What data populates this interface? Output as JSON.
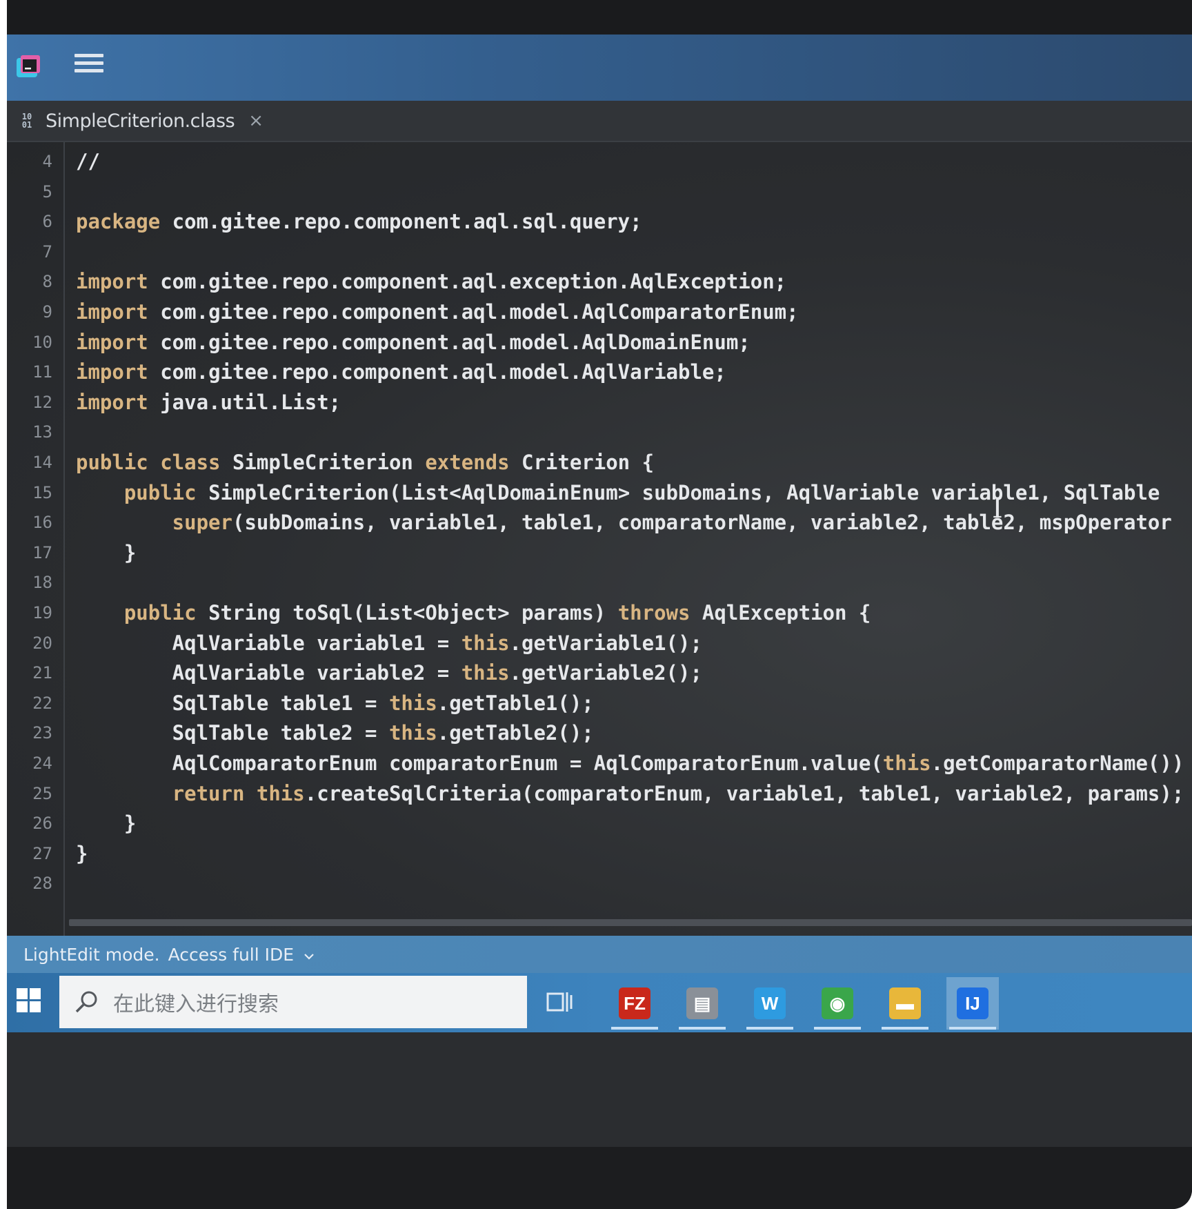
{
  "toolbar": {
    "app_icon": "intellij-lightedit-icon",
    "menu_icon": "hamburger-menu-icon"
  },
  "tab": {
    "icon": "class-file-icon",
    "icon_text": "10\n01",
    "label": "SimpleCriterion.class",
    "close": "×"
  },
  "editor": {
    "line_numbers": [
      "4",
      "5",
      "6",
      "7",
      "8",
      "9",
      "10",
      "11",
      "12",
      "13",
      "14",
      "15",
      "16",
      "17",
      "18",
      "19",
      "20",
      "21",
      "22",
      "23",
      "24",
      "25",
      "26",
      "27",
      "28"
    ],
    "lines": [
      [
        {
          "t": "//",
          "k": false
        }
      ],
      [],
      [
        {
          "t": "package",
          "k": true
        },
        {
          "t": " com.gitee.repo.component.aql.sql.query;",
          "k": false
        }
      ],
      [],
      [
        {
          "t": "import",
          "k": true
        },
        {
          "t": " com.gitee.repo.component.aql.exception.AqlException;",
          "k": false
        }
      ],
      [
        {
          "t": "import",
          "k": true
        },
        {
          "t": " com.gitee.repo.component.aql.model.AqlComparatorEnum;",
          "k": false
        }
      ],
      [
        {
          "t": "import",
          "k": true
        },
        {
          "t": " com.gitee.repo.component.aql.model.AqlDomainEnum;",
          "k": false
        }
      ],
      [
        {
          "t": "import",
          "k": true
        },
        {
          "t": " com.gitee.repo.component.aql.model.AqlVariable;",
          "k": false
        }
      ],
      [
        {
          "t": "import",
          "k": true
        },
        {
          "t": " java.util.List;",
          "k": false
        }
      ],
      [],
      [
        {
          "t": "public class",
          "k": true
        },
        {
          "t": " SimpleCriterion ",
          "k": false
        },
        {
          "t": "extends",
          "k": true
        },
        {
          "t": " Criterion {",
          "k": false
        }
      ],
      [
        {
          "t": "    public",
          "k": true
        },
        {
          "t": " SimpleCriterion(List<AqlDomainEnum> subDomains, AqlVariable variable1, SqlTable",
          "k": false
        }
      ],
      [
        {
          "t": "        super",
          "k": true
        },
        {
          "t": "(subDomains, variable1, table1, comparatorName, variable2, table2, mspOperator",
          "k": false
        }
      ],
      [
        {
          "t": "    }",
          "k": false
        }
      ],
      [],
      [
        {
          "t": "    public",
          "k": true
        },
        {
          "t": " String toSql(List<Object> params) ",
          "k": false
        },
        {
          "t": "throws",
          "k": true
        },
        {
          "t": " AqlException {",
          "k": false
        }
      ],
      [
        {
          "t": "        AqlVariable variable1 = ",
          "k": false
        },
        {
          "t": "this",
          "k": true
        },
        {
          "t": ".getVariable1();",
          "k": false
        }
      ],
      [
        {
          "t": "        AqlVariable variable2 = ",
          "k": false
        },
        {
          "t": "this",
          "k": true
        },
        {
          "t": ".getVariable2();",
          "k": false
        }
      ],
      [
        {
          "t": "        SqlTable table1 = ",
          "k": false
        },
        {
          "t": "this",
          "k": true
        },
        {
          "t": ".getTable1();",
          "k": false
        }
      ],
      [
        {
          "t": "        SqlTable table2 = ",
          "k": false
        },
        {
          "t": "this",
          "k": true
        },
        {
          "t": ".getTable2();",
          "k": false
        }
      ],
      [
        {
          "t": "        AqlComparatorEnum comparatorEnum = AqlComparatorEnum.value(",
          "k": false
        },
        {
          "t": "this",
          "k": true
        },
        {
          "t": ".getComparatorName())",
          "k": false
        }
      ],
      [
        {
          "t": "        return this",
          "k": true
        },
        {
          "t": ".createSqlCriteria(comparatorEnum, variable1, table1, variable2, params);",
          "k": false
        }
      ],
      [
        {
          "t": "    }",
          "k": false
        }
      ],
      [
        {
          "t": "}",
          "k": false
        }
      ],
      []
    ]
  },
  "statusbar": {
    "mode": "LightEdit mode.",
    "link": "Access full IDE",
    "chevron_icon": "chevron-down-icon"
  },
  "taskbar": {
    "start_icon": "windows-start-icon",
    "search_placeholder": "在此键入进行搜索",
    "search_icon": "search-icon",
    "task_view_icon": "task-view-icon",
    "apps": [
      {
        "name": "filezilla",
        "glyph": "FZ",
        "color": "#c9281b",
        "running": true,
        "active": false
      },
      {
        "name": "archive-tool",
        "glyph": "▤",
        "color": "#8a9098",
        "running": true,
        "active": false
      },
      {
        "name": "wps-writer",
        "glyph": "W",
        "color": "#2e9be0",
        "running": true,
        "active": false
      },
      {
        "name": "chrome",
        "glyph": "◉",
        "color": "#3aa64a",
        "running": true,
        "active": false
      },
      {
        "name": "file-explorer",
        "glyph": "▬",
        "color": "#e8b73a",
        "running": true,
        "active": false
      },
      {
        "name": "intellij-idea",
        "glyph": "IJ",
        "color": "#1f6fe0",
        "running": true,
        "active": true
      }
    ]
  },
  "colors": {
    "editor_bg": "#2b2d30",
    "keyword": "#d8b582",
    "text": "#e6e8eb",
    "statusbar": "#4e89b8",
    "taskbar": "#3e86c0"
  }
}
